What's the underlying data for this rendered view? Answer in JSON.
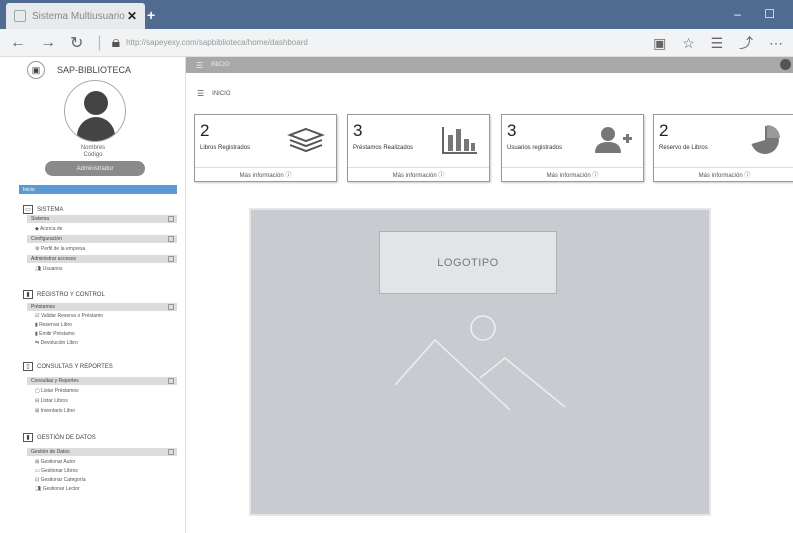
{
  "browser": {
    "tab_title": "Sistema Multiusuario",
    "url": "http://sapeyexy.com/sapbiblioteca/home/dashboard"
  },
  "sidebar": {
    "brand": "SAP-BIBLIOTECA",
    "user_name": "Nombres",
    "user_code": "Código",
    "role_button": "Administrador",
    "home": "Inicio",
    "sections": [
      {
        "title": "SISTEMA",
        "groups": [
          {
            "label": "Sistema",
            "items": [
              "Acerca de"
            ]
          },
          {
            "label": "Configuración",
            "items": [
              "Perfil de la empresa"
            ]
          },
          {
            "label": "Administrar accesos",
            "items": [
              "Usuarios"
            ]
          }
        ]
      },
      {
        "title": "REGISTRO Y CONTROL",
        "groups": [
          {
            "label": "Préstamos",
            "items": [
              "Validar Reserva o Préstamo",
              "Reservar Libro",
              "Emitir Préstamo",
              "Devolución Libro"
            ]
          }
        ]
      },
      {
        "title": "CONSULTAS Y REPORTES",
        "groups": [
          {
            "label": "Consultas y Reportes",
            "items": [
              "Listar Préstamos",
              "Listar Libros",
              "Inventario Libro"
            ]
          }
        ]
      },
      {
        "title": "GESTIÓN DE DATOS",
        "groups": [
          {
            "label": "Gestión de Datos",
            "items": [
              "Gestionar Autor",
              "Gestionar Libros",
              "Gestionar Categoría",
              "Gestionar Lector"
            ]
          }
        ]
      }
    ]
  },
  "topbar": {
    "title": "INICIO"
  },
  "breadcrumb": "INICIO",
  "cards": [
    {
      "value": "2",
      "label": "Libros Registrados",
      "more": "Más información ⓘ",
      "icon": "books-icon"
    },
    {
      "value": "3",
      "label": "Préstamos Realizados",
      "more": "Más información ⓘ",
      "icon": "bar-chart-icon"
    },
    {
      "value": "3",
      "label": "Usuarios registrados",
      "more": "Más información ⓘ",
      "icon": "add-user-icon"
    },
    {
      "value": "2",
      "label": "Reservo de Libros",
      "more": "Más información ⓘ",
      "icon": "pie-chart-icon"
    }
  ],
  "logo_placeholder": "LOGOTIPO"
}
